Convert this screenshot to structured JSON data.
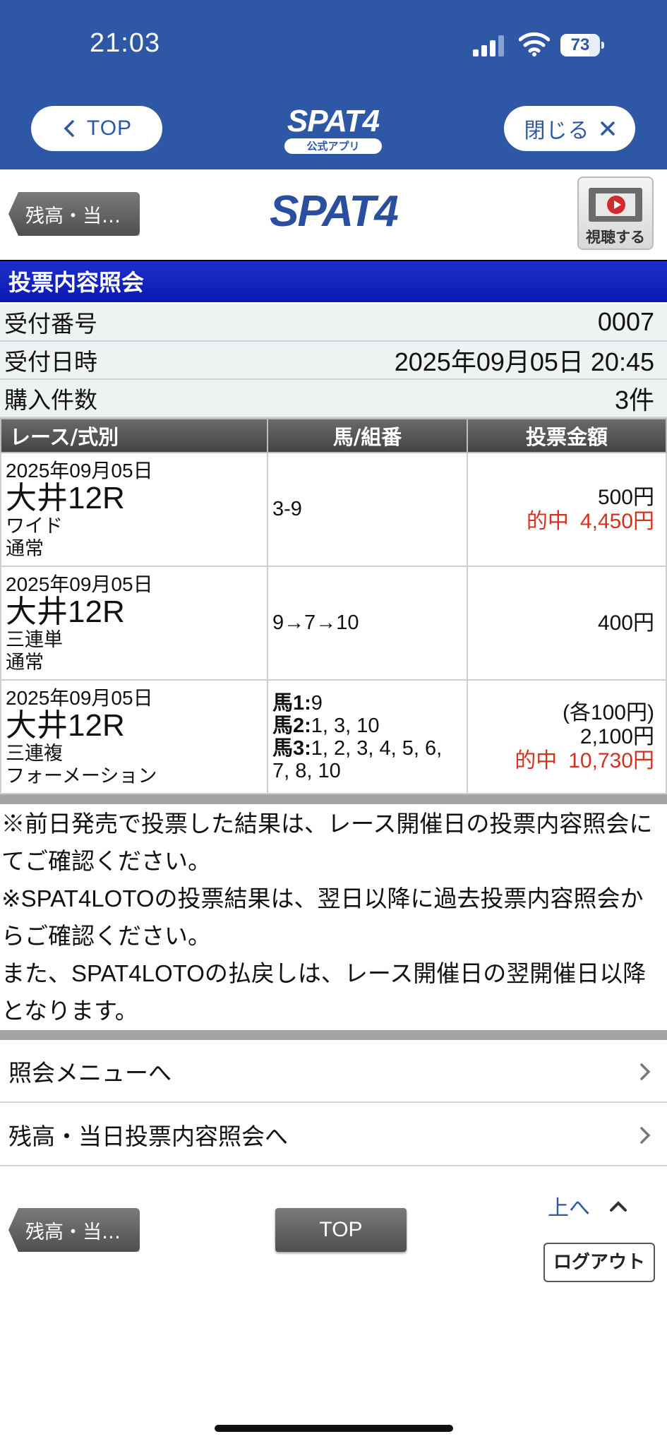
{
  "status_bar": {
    "time": "21:03",
    "battery": "73",
    "battery_level": 0.73
  },
  "app_header": {
    "top_button": "TOP",
    "logo_text": "SPAT4",
    "logo_sub": "公式アプリ",
    "close_button": "閉じる"
  },
  "page_header": {
    "back_button": "残高・当…",
    "logo_text": "SPAT4",
    "watch_button": "視聴する"
  },
  "section_title": "投票内容照会",
  "info": {
    "receipt_label": "受付番号",
    "receipt_value": "0007",
    "datetime_label": "受付日時",
    "datetime_value": "2025年09月05日 20:45",
    "count_label": "購入件数",
    "count_value": "3件"
  },
  "table": {
    "headers": [
      "レース/式別",
      "馬/組番",
      "投票金額"
    ],
    "rows": [
      {
        "date": "2025年09月05日",
        "race": "大井12R",
        "bet_type": "ワイド",
        "method": "通常",
        "combo": "3-9",
        "amount": "500円",
        "hit_label": "的中",
        "hit_amount": "4,450円"
      },
      {
        "date": "2025年09月05日",
        "race": "大井12R",
        "bet_type": "三連単",
        "method": "通常",
        "combo": "9→7→10",
        "amount": "400円"
      },
      {
        "date": "2025年09月05日",
        "race": "大井12R",
        "bet_type": "三連複",
        "method": "フォーメーション",
        "combo_lines": [
          {
            "label": "馬1:",
            "value": "9"
          },
          {
            "label": "馬2:",
            "value": "1, 3, 10"
          },
          {
            "label": "馬3:",
            "value": "1, 2, 3, 4, 5, 6,"
          }
        ],
        "combo_tail": "7, 8, 10",
        "unit": "(各100円)",
        "amount": "2,100円",
        "hit_label": "的中",
        "hit_amount": "10,730円"
      }
    ]
  },
  "notes": [
    "※前日発売で投票した結果は、レース開催日の投票内容照会にてご確認ください。",
    "※SPAT4LOTOの投票結果は、翌日以降に過去投票内容照会からご確認ください。",
    "また、SPAT4LOTOの払戻しは、レース開催日の翌開催日以降となります。"
  ],
  "links": {
    "menu": "照会メニューへ",
    "balance": "残高・当日投票内容照会へ"
  },
  "footer": {
    "back_button": "残高・当…",
    "top_button": "TOP",
    "up_link": "上へ",
    "logout_button": "ログアウト"
  },
  "colors": {
    "header_blue": "#2e57a5",
    "section_blue": "#0a19b3",
    "hit_red": "#d6311f"
  }
}
